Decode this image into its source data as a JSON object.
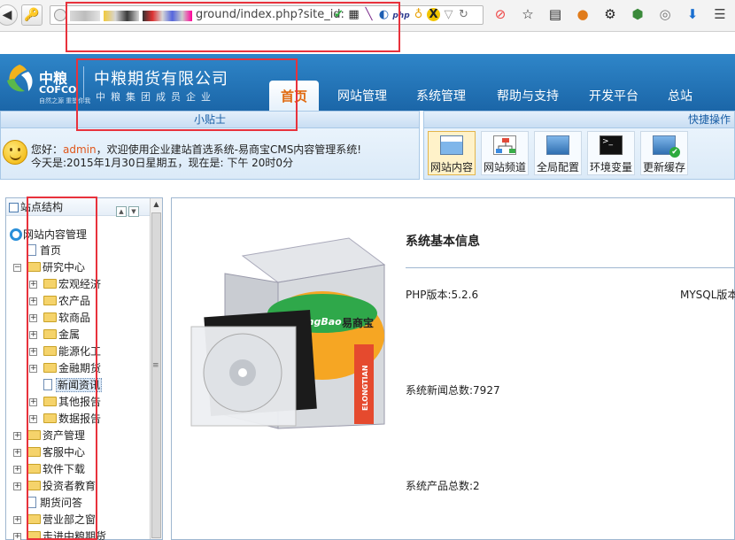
{
  "browser": {
    "url_text": "ground/index.php?site_id:",
    "back_glyph": "◀",
    "key_glyph": "🔑"
  },
  "header": {
    "logo_cn": "中粮",
    "logo_en": "COFCO",
    "logo_sub": "自然之源 重塑你我",
    "company_name": "中粮期货有限公司",
    "company_sub": "中粮集团成员企业",
    "tabs": [
      {
        "label": "首页",
        "active": true
      },
      {
        "label": "网站管理",
        "active": false
      },
      {
        "label": "系统管理",
        "active": false
      },
      {
        "label": "帮助与支持",
        "active": false
      },
      {
        "label": "开发平台",
        "active": false
      },
      {
        "label": "总站",
        "active": false
      }
    ]
  },
  "tips": {
    "title": "小贴士",
    "hello": "您好：",
    "username": "admin",
    "welcome_text": "，欢迎使用企业建站首选系统-易商宝CMS内容管理系统!",
    "date_text": "今天是:2015年1月30日星期五，现在是: 下午 20时0分"
  },
  "quick_ops": {
    "title": "快捷操作",
    "items": [
      {
        "label": "网站内容",
        "active": true
      },
      {
        "label": "网站频道",
        "active": false
      },
      {
        "label": "全局配置",
        "active": false
      },
      {
        "label": "环境变量",
        "active": false
      },
      {
        "label": "更新缓存",
        "active": false
      }
    ]
  },
  "tree": {
    "title": "站点结构",
    "root": "网站内容管理",
    "nodes": [
      {
        "label": "首页",
        "type": "page"
      },
      {
        "label": "研究中心",
        "type": "folder",
        "expanded": true
      },
      {
        "label": "宏观经济",
        "type": "folder"
      },
      {
        "label": "农产品",
        "type": "folder"
      },
      {
        "label": "软商品",
        "type": "folder"
      },
      {
        "label": "金属",
        "type": "folder"
      },
      {
        "label": "能源化工",
        "type": "folder"
      },
      {
        "label": "金融期货",
        "type": "folder"
      },
      {
        "label": "新闻资讯",
        "type": "page",
        "selected": true
      },
      {
        "label": "其他报告",
        "type": "folder"
      },
      {
        "label": "数据报告",
        "type": "folder"
      },
      {
        "label": "资产管理",
        "type": "folder"
      },
      {
        "label": "客服中心",
        "type": "folder"
      },
      {
        "label": "软件下载",
        "type": "folder"
      },
      {
        "label": "投资者教育",
        "type": "folder"
      },
      {
        "label": "期货问答",
        "type": "page"
      },
      {
        "label": "营业部之窗",
        "type": "folder"
      },
      {
        "label": "走进中粮期货",
        "type": "folder"
      }
    ]
  },
  "main": {
    "product_brand": "eShangBao",
    "product_brand_cn": "易商宝",
    "product_vendor": "ELONGTIAN",
    "info_title": "系统基本信息",
    "php_version": "PHP版本:5.2.6",
    "mysql_version": "MYSQL版本",
    "news_total": "系统新闻总数:7927",
    "product_total": "系统产品总数:2"
  },
  "colors": {
    "header_blue": "#1b66a8",
    "active_tab_text": "#e06a10",
    "annotation_red": "#e8323c",
    "username_orange": "#e0561a"
  }
}
